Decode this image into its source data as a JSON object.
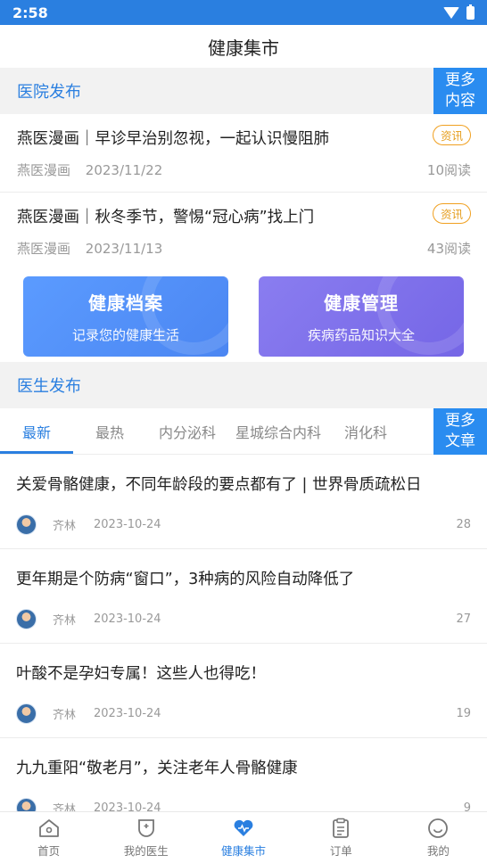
{
  "status_bar": {
    "time": "2:58"
  },
  "header": {
    "title": "健康集市"
  },
  "hospital_section": {
    "title": "医院发布",
    "more_line1": "更多",
    "more_line2": "内容",
    "items": [
      {
        "title": "燕医漫画｜早诊早治别忽视，一起认识慢阻肺",
        "tag": "资讯",
        "source": "燕医漫画",
        "date": "2023/11/22",
        "reads": "10阅读"
      },
      {
        "title": "燕医漫画｜秋冬季节，警惕“冠心病”找上门",
        "tag": "资讯",
        "source": "燕医漫画",
        "date": "2023/11/13",
        "reads": "43阅读"
      }
    ]
  },
  "cards": [
    {
      "title": "健康档案",
      "subtitle": "记录您的健康生活"
    },
    {
      "title": "健康管理",
      "subtitle": "疾病药品知识大全"
    }
  ],
  "doctor_section": {
    "title": "医生发布",
    "more_line1": "更多",
    "more_line2": "文章",
    "tabs": [
      "最新",
      "最热",
      "内分泌科",
      "星城综合内科",
      "消化科"
    ],
    "articles": [
      {
        "title": "关爱骨骼健康，不同年龄段的要点都有了 | 世界骨质疏松日",
        "author": "齐林",
        "date": "2023-10-24",
        "views": "28"
      },
      {
        "title": "更年期是个防病“窗口”，3种病的风险自动降低了",
        "author": "齐林",
        "date": "2023-10-24",
        "views": "27"
      },
      {
        "title": "叶酸不是孕妇专属！这些人也得吃！",
        "author": "齐林",
        "date": "2023-10-24",
        "views": "19"
      },
      {
        "title": "九九重阳“敬老月”，关注老年人骨骼健康",
        "author": "齐林",
        "date": "2023-10-24",
        "views": "9"
      }
    ]
  },
  "bottom_nav": {
    "items": [
      {
        "label": "首页",
        "icon": "home-icon"
      },
      {
        "label": "我的医生",
        "icon": "doctor-icon"
      },
      {
        "label": "健康集市",
        "icon": "heart-icon"
      },
      {
        "label": "订单",
        "icon": "clipboard-icon"
      },
      {
        "label": "我的",
        "icon": "smile-icon"
      }
    ],
    "active_index": 2
  },
  "colors": {
    "accent": "#2a7fe0",
    "tag": "#e59c1a"
  }
}
